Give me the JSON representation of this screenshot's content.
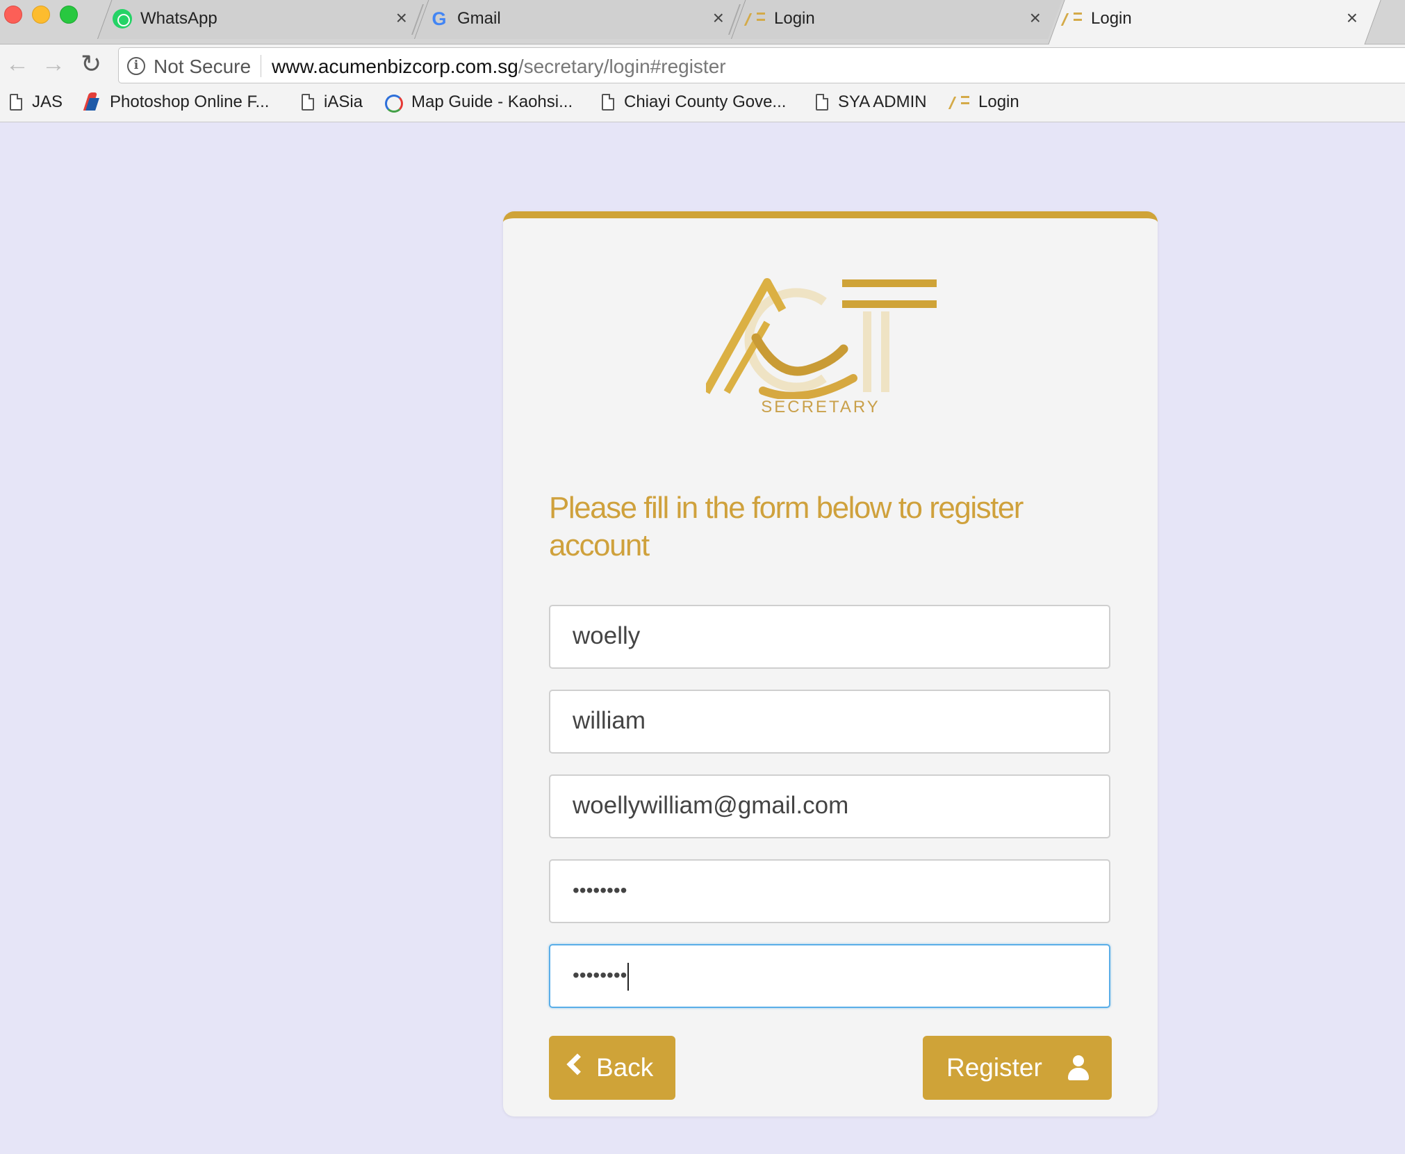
{
  "browser": {
    "tabs": [
      {
        "title": "WhatsApp",
        "icon": "whatsapp-icon"
      },
      {
        "title": "Gmail",
        "icon": "google-icon"
      },
      {
        "title": "Login",
        "icon": "act-favicon"
      },
      {
        "title": "Login",
        "icon": "act-favicon",
        "active": true
      }
    ],
    "tab_close_glyph": "×",
    "omnibox": {
      "security_label": "Not Secure",
      "url_host": "www.acumenbizcorp.com.sg",
      "url_path": "/secretary/login#register"
    },
    "bookmarks": [
      {
        "label": "JAS",
        "icon": "page-icon"
      },
      {
        "label": "Photoshop Online F...",
        "icon": "photoshop-icon"
      },
      {
        "label": "iASia",
        "icon": "page-icon"
      },
      {
        "label": "Map Guide - Kaohsi...",
        "icon": "map-icon"
      },
      {
        "label": "Chiayi County Gove...",
        "icon": "page-icon"
      },
      {
        "label": "SYA ADMIN",
        "icon": "page-icon"
      },
      {
        "label": "Login",
        "icon": "act-favicon"
      }
    ]
  },
  "page": {
    "logo": {
      "wordmark": "ACT",
      "subtitle": "SECRETARY"
    },
    "heading": "Please fill in the form below to register account",
    "fields": [
      {
        "value": "woelly"
      },
      {
        "value": "william"
      },
      {
        "value": "woellywilliam@gmail.com"
      },
      {
        "value": "••••••••",
        "type": "password"
      },
      {
        "value": "••••••••",
        "type": "password",
        "focused": true
      }
    ],
    "back_label": "Back",
    "register_label": "Register"
  },
  "colors": {
    "accent": "#cfa338",
    "page_background": "#e6e5f7",
    "card_background": "#f4f4f4",
    "focus_border": "#5aaee8"
  }
}
